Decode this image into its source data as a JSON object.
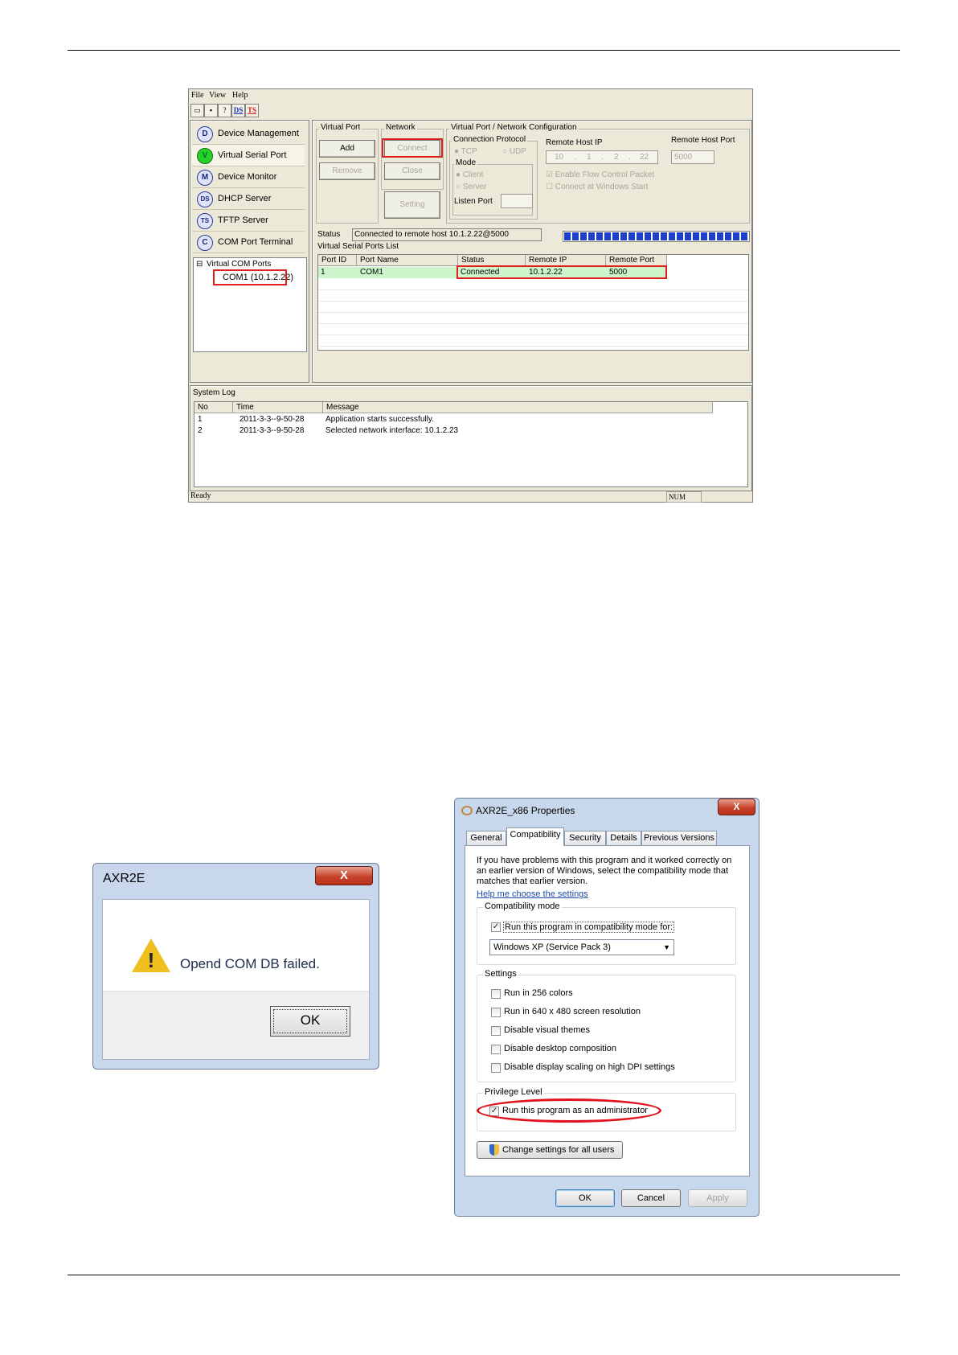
{
  "app": {
    "menu": [
      "File",
      "View",
      "Help"
    ],
    "toolbar_icons": [
      "open-icon",
      "save-icon",
      "help-icon",
      "ds-icon",
      "ts-icon"
    ],
    "toolbar_labels": {
      "ds": "DS",
      "ts": "TS",
      "help": "?"
    },
    "nav": [
      {
        "icon": "D",
        "label": "Device Management"
      },
      {
        "icon": "V",
        "label": "Virtual Serial Port"
      },
      {
        "icon": "M",
        "label": "Device Monitor"
      },
      {
        "icon": "DS",
        "label": "DHCP Server"
      },
      {
        "icon": "TS",
        "label": "TFTP Server"
      },
      {
        "icon": "C",
        "label": "COM Port Terminal"
      }
    ],
    "tree": {
      "root": "Virtual COM Ports",
      "child": "COM1 (10.1.2.22)",
      "expander": "⊟"
    },
    "virtual_port": {
      "label": "Virtual Port",
      "add": "Add",
      "remove": "Remove"
    },
    "network": {
      "label": "Network",
      "connect": "Connect",
      "close": "Close",
      "setting": "Setting"
    },
    "config": {
      "label": "Virtual Port / Network Configuration",
      "protocol_label": "Connection Protocol",
      "tcp": "TCP",
      "udp": "UDP",
      "mode_label": "Mode",
      "client": "Client",
      "server": "Server",
      "listen_port": "Listen Port",
      "remote_ip_label": "Remote Host IP",
      "ip": [
        "10",
        "1",
        "2",
        "22"
      ],
      "ip_sep": ".",
      "remote_port_label": "Remote Host Port",
      "remote_port": "5000",
      "flow_control": "Enable Flow Control Packet",
      "connect_at_start": "Connect at Windows Start",
      "check_mark": "☑",
      "uncheck_mark": "☐"
    },
    "status_label": "Status",
    "status_value": "Connected to remote host 10.1.2.22@5000",
    "progress": 1.0,
    "ports_list": {
      "label": "Virtual Serial Ports List",
      "columns": [
        "Port ID",
        "Port Name",
        "Status",
        "Remote IP",
        "Remote Port"
      ],
      "rows": [
        [
          "1",
          "COM1",
          "Connected",
          "10.1.2.22",
          "5000"
        ]
      ]
    },
    "log": {
      "label": "System Log",
      "columns": [
        "No",
        "Time",
        "Message"
      ],
      "rows": [
        [
          "1",
          "2011-3-3--9-50-28",
          "Application starts successfully."
        ],
        [
          "2",
          "2011-3-3--9-50-28",
          "Selected network interface: 10.1.2.23"
        ]
      ]
    },
    "statusbar": {
      "left": "Ready",
      "num": "NUM"
    }
  },
  "error_dialog": {
    "title": "AXR2E",
    "message": "Opend COM DB failed.",
    "ok": "OK",
    "close": "X",
    "warn_mark": "!"
  },
  "properties": {
    "title": "AXR2E_x86 Properties",
    "close": "X",
    "tabs": [
      "General",
      "Compatibility",
      "Security",
      "Details",
      "Previous Versions"
    ],
    "intro": [
      "If you have problems with this program and it worked correctly on",
      "an earlier version of Windows, select the compatibility mode that",
      "matches that earlier version."
    ],
    "help_link": "Help me choose the settings",
    "compat_group": "Compatibility mode",
    "compat_check": "Run this program in compatibility mode for:",
    "compat_select": "Windows XP (Service Pack 3)",
    "select_arrow": "▼",
    "settings_group": "Settings",
    "settings": [
      "Run in 256 colors",
      "Run in 640 x 480 screen resolution",
      "Disable visual themes",
      "Disable desktop composition",
      "Disable display scaling on high DPI settings"
    ],
    "privilege_group": "Privilege Level",
    "admin_check": "Run this program as an administrator",
    "change_all": "Change settings for all users",
    "check": "✓",
    "ok": "OK",
    "cancel": "Cancel",
    "apply": "Apply"
  }
}
